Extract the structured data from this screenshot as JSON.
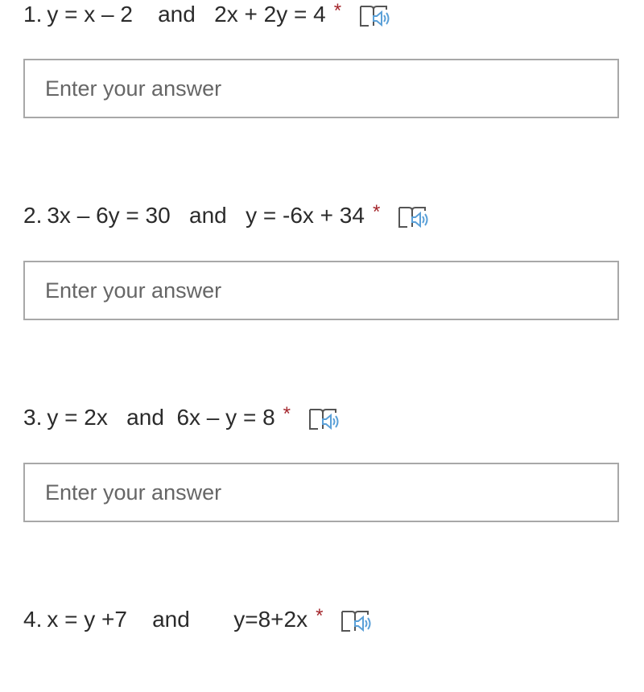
{
  "questions": [
    {
      "number": "1.",
      "title": "y = x – 2    and   2x + 2y = 4",
      "required_mark": "*",
      "reader_icon": "immersive-reader-icon",
      "answer_value": "",
      "answer_placeholder": "Enter your answer"
    },
    {
      "number": "2.",
      "title": "3x – 6y = 30   and   y = -6x + 34",
      "required_mark": "*",
      "reader_icon": "immersive-reader-icon",
      "answer_value": "",
      "answer_placeholder": "Enter your answer"
    },
    {
      "number": "3.",
      "title": "y = 2x   and  6x – y = 8",
      "required_mark": "*",
      "reader_icon": "immersive-reader-icon",
      "answer_value": "",
      "answer_placeholder": "Enter your answer"
    },
    {
      "number": "4.",
      "title": "x = y +7    and       y=8+2x",
      "required_mark": "*",
      "reader_icon": "immersive-reader-icon"
    }
  ],
  "colors": {
    "required": "#a4262c",
    "reader_accent": "#5aa0d8",
    "border": "#a8a8a8"
  }
}
